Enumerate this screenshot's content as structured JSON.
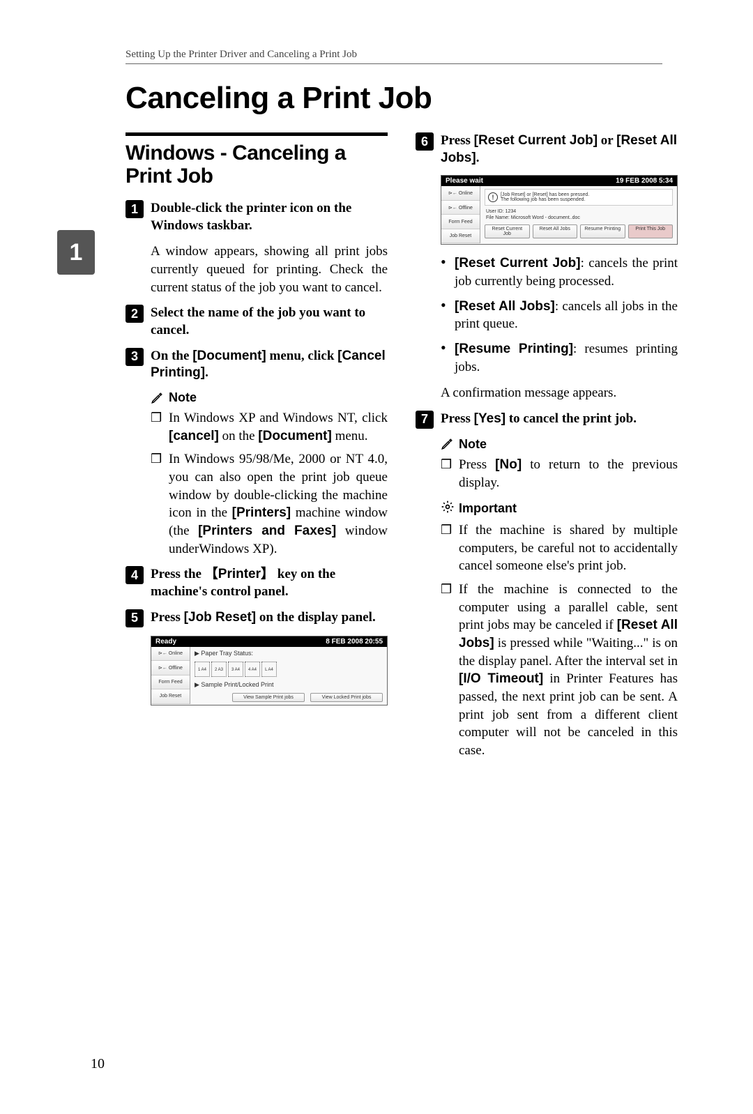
{
  "header_line": "Setting Up the Printer Driver and Canceling a Print Job",
  "side_tab": "1",
  "main_title": "Canceling a Print Job",
  "left": {
    "section_heading": "Windows - Canceling a Print Job",
    "s1": "Double-click the printer icon on the Windows taskbar.",
    "p1": "A window appears, showing all print jobs currently queued for printing. Check the current status of the job you want to cancel.",
    "s2": "Select the name of the job you want to cancel.",
    "s3_a": "On the ",
    "s3_b": "[Document]",
    "s3_c": " menu, click ",
    "s3_d": "[Cancel Printing]",
    "s3_e": ".",
    "note_label": "Note",
    "n1_a": "In Windows XP and Windows NT, click ",
    "n1_b": "[cancel]",
    "n1_c": " on the ",
    "n1_d": "[Document]",
    "n1_e": " menu.",
    "n2_a": "In Windows 95/98/Me, 2000 or NT 4.0, you can also open the print job queue window by double-clicking the machine icon in the ",
    "n2_b": "[Printers]",
    "n2_c": " machine window (the ",
    "n2_d": "[Printers and Faxes]",
    "n2_e": " window underWindows XP).",
    "s4_a": "Press the ",
    "s4_key": "Printer",
    "s4_b": " key on the machine's control panel.",
    "s5_a": "Press ",
    "s5_b": "[Job Reset]",
    "s5_c": " on the display panel."
  },
  "right": {
    "s6_a": "Press ",
    "s6_b": "[Reset Current Job]",
    "s6_c": " or ",
    "s6_d": "[Reset All Jobs]",
    "s6_e": ".",
    "b1_a": "[Reset Current Job]",
    "b1_b": ": cancels the print job currently being processed.",
    "b2_a": "[Reset All Jobs]",
    "b2_b": ": cancels all jobs in the print queue.",
    "b3_a": "[Resume Printing]",
    "b3_b": ": resumes printing jobs.",
    "p2": "A confirmation message appears.",
    "s7_a": "Press ",
    "s7_b": "[Yes]",
    "s7_c": " to cancel the print job.",
    "note_label": "Note",
    "n3_a": "Press ",
    "n3_b": "[No]",
    "n3_c": " to return to the previous display.",
    "important_label": "Important",
    "imp1": "If the machine is shared by multiple computers, be careful not to accidentally cancel someone else's print job.",
    "imp2_a": "If the machine is connected to the computer using a parallel cable, sent print jobs may be canceled if ",
    "imp2_b": "[Reset All Jobs]",
    "imp2_c": " is pressed while \"Waiting...\" is on the display panel. After the interval set in ",
    "imp2_d": "[I/O Timeout]",
    "imp2_e": " in Printer Features has passed, the next print job can be sent. A print job sent from a different client computer will not be canceled in this case."
  },
  "panel_ready": {
    "title": "Ready",
    "date": "8  FEB    2008 20:55",
    "side": [
      "⊳← Online",
      "⊳← Offline",
      "Form Feed",
      "Job Reset"
    ],
    "tray_label": "▶ Paper Tray Status:",
    "trays": [
      "1  A4",
      "2  A3",
      "3  A4",
      "4  A4",
      "L  A4"
    ],
    "sp_label": "▶ Sample Print/Locked Print",
    "btn1": "View Sample Print jobs",
    "btn2": "View Locked Print jobs"
  },
  "panel_wait": {
    "title": "Please wait",
    "date": "19 FEB   2008  5:34",
    "side": [
      "⊳← Online",
      "⊳← Offline",
      "Form Feed",
      "Job Reset"
    ],
    "msg_a": "[Job Reset] or [Reset] has been pressed.",
    "msg_b": "The following job has been suspended.",
    "file1": "User ID: 1234",
    "file2": "File Name: Microsoft Word - document..doc",
    "btn1": "Reset Current Job",
    "btn2": "Reset All Jobs",
    "btn3": "Resume Printing",
    "btn4": "Print This Job"
  },
  "page_number": "10"
}
